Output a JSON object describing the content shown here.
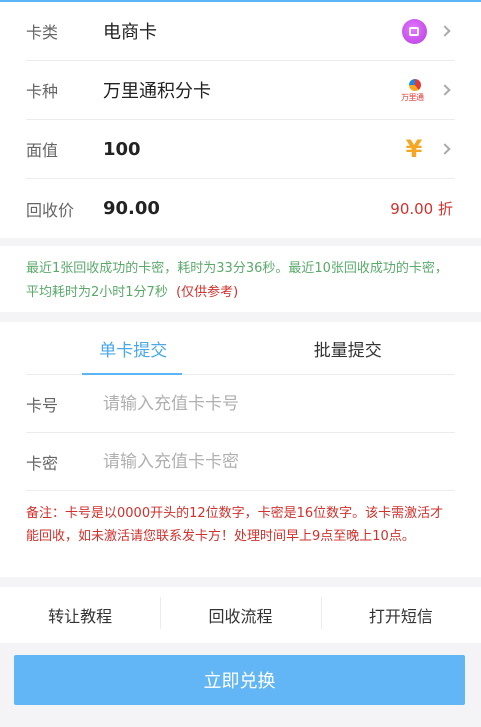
{
  "card": {
    "type_label": "卡类",
    "type_value": "电商卡",
    "kind_label": "万里通积分卡",
    "kind_title": "卡种",
    "kind_icon_text": "万里通",
    "face_label": "面值",
    "face_value": "100",
    "face_icon": "¥",
    "recycle_label": "回收价",
    "recycle_value": "90.00",
    "recycle_rate": "90.00 折"
  },
  "notice": {
    "text": "最近1张回收成功的卡密，耗时为33分36秒。最近10张回收成功的卡密，平均耗时为2小时1分7秒",
    "ref": "(仅供参考)"
  },
  "tabs": [
    "单卡提交",
    "批量提交"
  ],
  "form": {
    "card_no_label": "卡号",
    "card_no_placeholder": "请输入充值卡卡号",
    "card_pwd_label": "卡密",
    "card_pwd_placeholder": "请输入充值卡卡密"
  },
  "note": "备注：卡号是以0000开头的12位数字，卡密是16位数字。该卡需激活才能回收，如未激活请您联系发卡方！处理时间早上9点至晚上10点。",
  "links": [
    "转让教程",
    "回收流程",
    "打开短信"
  ],
  "submit_label": "立即兑换",
  "colors": {
    "accent": "#5bb5f5",
    "price": "#d0312d",
    "notice": "#5aa96b"
  }
}
